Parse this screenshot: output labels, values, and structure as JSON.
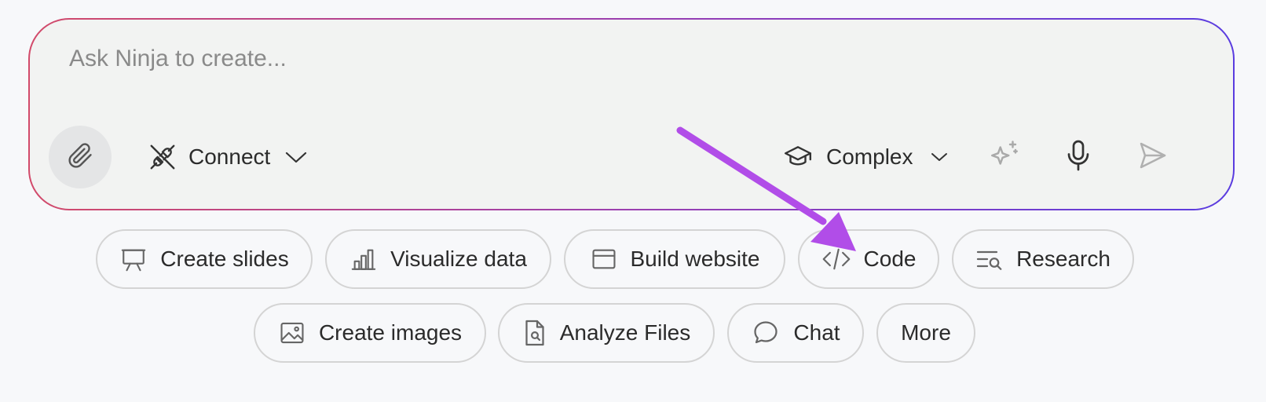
{
  "prompt": {
    "placeholder": "Ask Ninja to create...",
    "value": ""
  },
  "toolbar": {
    "attach_icon": "paperclip-icon",
    "connect_label": "Connect",
    "connect_icon": "plug-icon",
    "mode_label": "Complex",
    "mode_icon": "graduation-cap-icon",
    "sparkle_icon": "sparkle-icon",
    "mic_icon": "microphone-icon",
    "send_icon": "send-icon"
  },
  "quick_actions": {
    "row1": [
      {
        "label": "Create slides",
        "icon": "presentation-board-icon"
      },
      {
        "label": "Visualize data",
        "icon": "bar-chart-icon"
      },
      {
        "label": "Build website",
        "icon": "browser-window-icon"
      },
      {
        "label": "Code",
        "icon": "code-icon"
      },
      {
        "label": "Research",
        "icon": "search-list-icon"
      }
    ],
    "row2": [
      {
        "label": "Create images",
        "icon": "image-icon"
      },
      {
        "label": "Analyze Files",
        "icon": "file-search-icon"
      },
      {
        "label": "Chat",
        "icon": "chat-bubble-icon"
      },
      {
        "label": "More",
        "icon": ""
      }
    ]
  },
  "annotation": {
    "arrow_color": "#b14de8",
    "points_to": "Code"
  },
  "colors": {
    "border_gradient_start": "#d24a6a",
    "border_gradient_end": "#5a3ce0",
    "prompt_bg": "#f2f3f2",
    "page_bg": "#f7f8fa"
  }
}
